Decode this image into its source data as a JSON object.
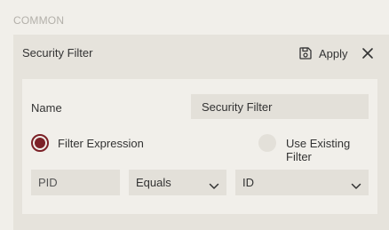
{
  "section": {
    "title": "COMMON"
  },
  "panel": {
    "title": "Security Filter",
    "apply_label": "Apply",
    "apply_icon": "save-icon",
    "close_icon": "close-icon"
  },
  "form": {
    "name_label": "Name",
    "name_value": "Security Filter",
    "radio_options": [
      {
        "label": "Filter Expression",
        "selected": true
      },
      {
        "label": "Use Existing Filter",
        "selected": false
      }
    ],
    "expression": {
      "field_value": "PID",
      "operator": "Equals",
      "value": "ID"
    }
  },
  "colors": {
    "accent": "#7c2127",
    "page_bg": "#f1efea",
    "panel_bg": "#e6e3dc",
    "field_bg": "#e3e0d9"
  }
}
